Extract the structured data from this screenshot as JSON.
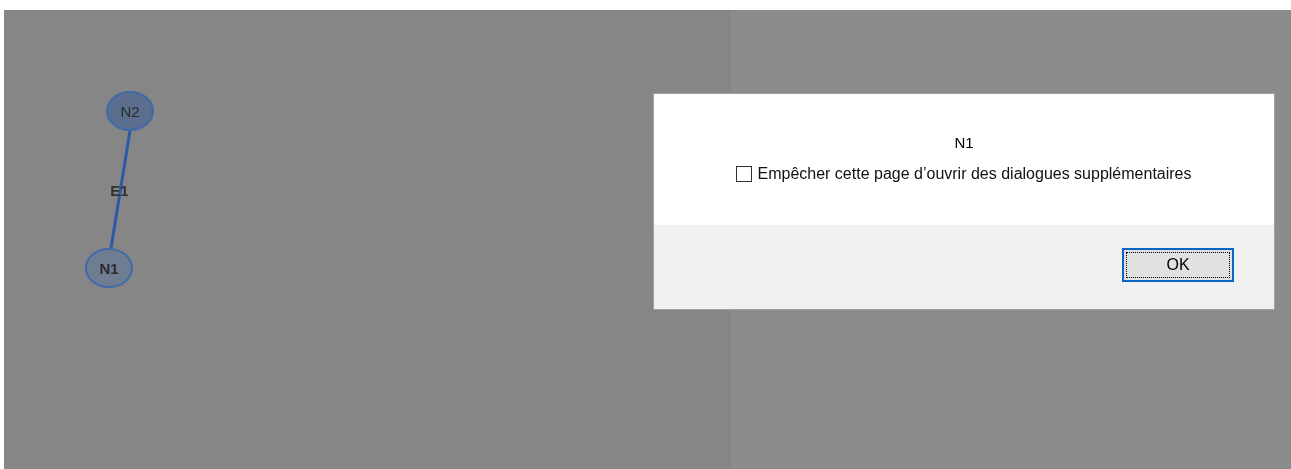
{
  "graph": {
    "nodes": [
      {
        "label": "N2",
        "selected": false
      },
      {
        "label": "N1",
        "selected": true
      }
    ],
    "edges": [
      {
        "label": "E1"
      }
    ]
  },
  "dialog": {
    "message": "N1",
    "checkbox": {
      "label": "Empêcher cette page d’ouvrir des dialogues supplémentaires",
      "checked": false
    },
    "buttons": [
      "OK"
    ]
  }
}
